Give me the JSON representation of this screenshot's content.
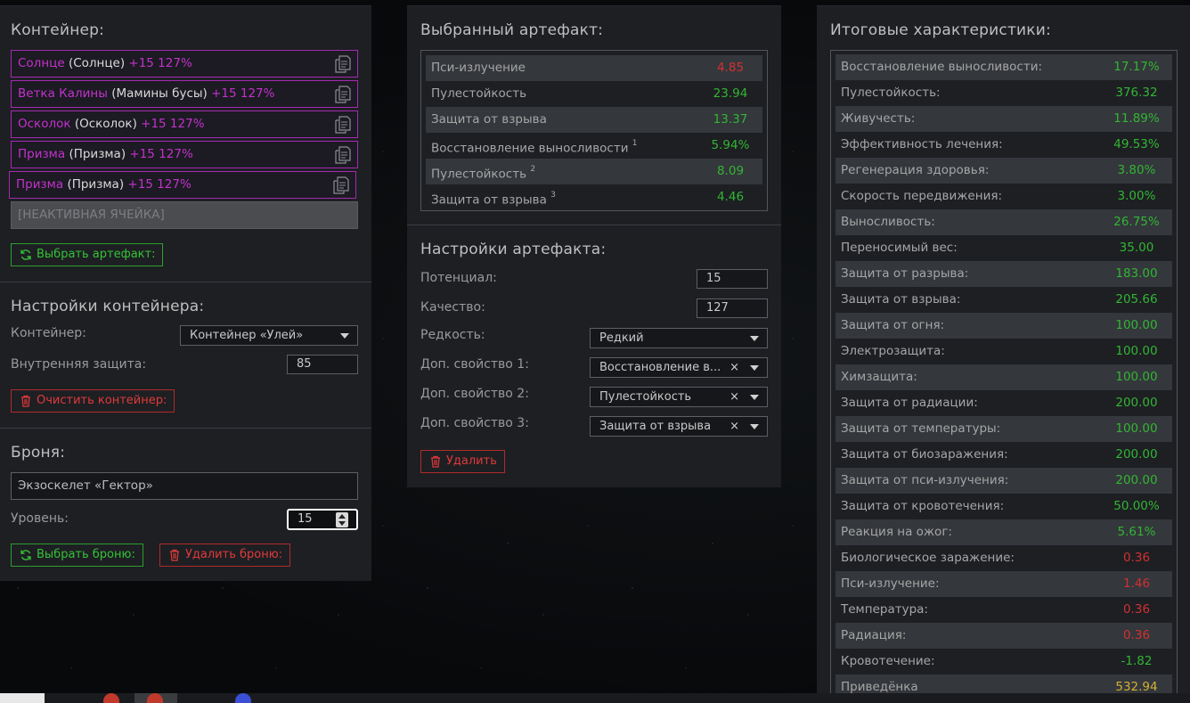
{
  "left": {
    "container_title": "Контейнер:",
    "slots": [
      {
        "name": "Солнце",
        "sub": "(Солнце)",
        "bonus": "+15 127%"
      },
      {
        "name": "Ветка Калины",
        "sub": "(Мамины бусы)",
        "bonus": "+15 127%"
      },
      {
        "name": "Осколок",
        "sub": "(Осколок)",
        "bonus": "+15 127%"
      },
      {
        "name": "Призма",
        "sub": "(Призма)",
        "bonus": "+15 127%"
      },
      {
        "name": "Призма",
        "sub": "(Призма)",
        "bonus": "+15 127%"
      }
    ],
    "inactive_slot": "[НЕАКТИВНАЯ ЯЧЕЙКА]",
    "choose_artifact": "Выбрать артефакт:",
    "container_settings_title": "Настройки контейнера:",
    "container_label": "Контейнер:",
    "container_value": "Контейнер «Улей»",
    "inner_protection_label": "Внутренняя защита:",
    "inner_protection_value": "85",
    "clear_container": "Очистить контейнер:",
    "armor_title": "Броня:",
    "armor_value": "Экзоскелет «Гектор»",
    "level_label": "Уровень:",
    "level_value": "15",
    "choose_armor": "Выбрать броню:",
    "delete_armor": "Удалить броню:"
  },
  "mid": {
    "selected_title": "Выбранный артефакт:",
    "stats": [
      {
        "name": "Пси-излучение",
        "sup": "",
        "value": "4.85",
        "color": "#d33030"
      },
      {
        "name": "Пулестойкость",
        "sup": "",
        "value": "23.94",
        "color": "#33b533"
      },
      {
        "name": "Защита от взрыва",
        "sup": "",
        "value": "13.37",
        "color": "#33b533"
      },
      {
        "name": "Восстановление выносливости",
        "sup": "1",
        "value": "5.94%",
        "color": "#33b533"
      },
      {
        "name": "Пулестойкость",
        "sup": "2",
        "value": "8.09",
        "color": "#33b533"
      },
      {
        "name": "Защита от взрыва",
        "sup": "3",
        "value": "4.46",
        "color": "#33b533"
      }
    ],
    "settings_title": "Настройки артефакта:",
    "potential_label": "Потенциал:",
    "potential_value": "15",
    "quality_label": "Качество:",
    "quality_value": "127",
    "rarity_label": "Редкость:",
    "rarity_value": "Редкий",
    "extra1_label": "Доп. свойство 1:",
    "extra1_value": "Восстановление в...",
    "extra2_label": "Доп. свойство 2:",
    "extra2_value": "Пулестойкость",
    "extra3_label": "Доп. свойство 3:",
    "extra3_value": "Защита от взрыва",
    "clear_glyph": "×",
    "delete": "Удалить"
  },
  "right": {
    "title": "Итоговые характеристики:",
    "stats": [
      {
        "name": "Восстановление выносливости:",
        "value": "17.17%",
        "color": "#33b533"
      },
      {
        "name": "Пулестойкость:",
        "value": "376.32",
        "color": "#33b533"
      },
      {
        "name": "Живучесть:",
        "value": "11.89%",
        "color": "#33b533"
      },
      {
        "name": "Эффективность лечения:",
        "value": "49.53%",
        "color": "#33b533"
      },
      {
        "name": "Регенерация здоровья:",
        "value": "3.80%",
        "color": "#33b533"
      },
      {
        "name": "Скорость передвижения:",
        "value": "3.00%",
        "color": "#33b533"
      },
      {
        "name": "Выносливость:",
        "value": "26.75%",
        "color": "#33b533"
      },
      {
        "name": "Переносимый вес:",
        "value": "35.00",
        "color": "#33b533"
      },
      {
        "name": "Защита от разрыва:",
        "value": "183.00",
        "color": "#33b533"
      },
      {
        "name": "Защита от взрыва:",
        "value": "205.66",
        "color": "#33b533"
      },
      {
        "name": "Защита от огня:",
        "value": "100.00",
        "color": "#33b533"
      },
      {
        "name": "Электрозащита:",
        "value": "100.00",
        "color": "#33b533"
      },
      {
        "name": "Химзащита:",
        "value": "100.00",
        "color": "#33b533"
      },
      {
        "name": "Защита от радиации:",
        "value": "200.00",
        "color": "#33b533"
      },
      {
        "name": "Защита от температуры:",
        "value": "100.00",
        "color": "#33b533"
      },
      {
        "name": "Защита от биозаражения:",
        "value": "200.00",
        "color": "#33b533"
      },
      {
        "name": "Защита от пси-излучения:",
        "value": "200.00",
        "color": "#33b533"
      },
      {
        "name": "Защита от кровотечения:",
        "value": "50.00%",
        "color": "#33b533"
      },
      {
        "name": "Реакция на ожог:",
        "value": "5.61%",
        "color": "#33b533"
      },
      {
        "name": "Биологическое заражение:",
        "value": "0.36",
        "color": "#d33030"
      },
      {
        "name": "Пси-излучение:",
        "value": "1.46",
        "color": "#d33030"
      },
      {
        "name": "Температура:",
        "value": "0.36",
        "color": "#d33030"
      },
      {
        "name": "Радиация:",
        "value": "0.36",
        "color": "#d33030"
      },
      {
        "name": "Кровотечение:",
        "value": "-1.82",
        "color": "#33b533"
      },
      {
        "name": "Приведёнка",
        "value": "532.94",
        "color": "#d5b033"
      }
    ]
  }
}
